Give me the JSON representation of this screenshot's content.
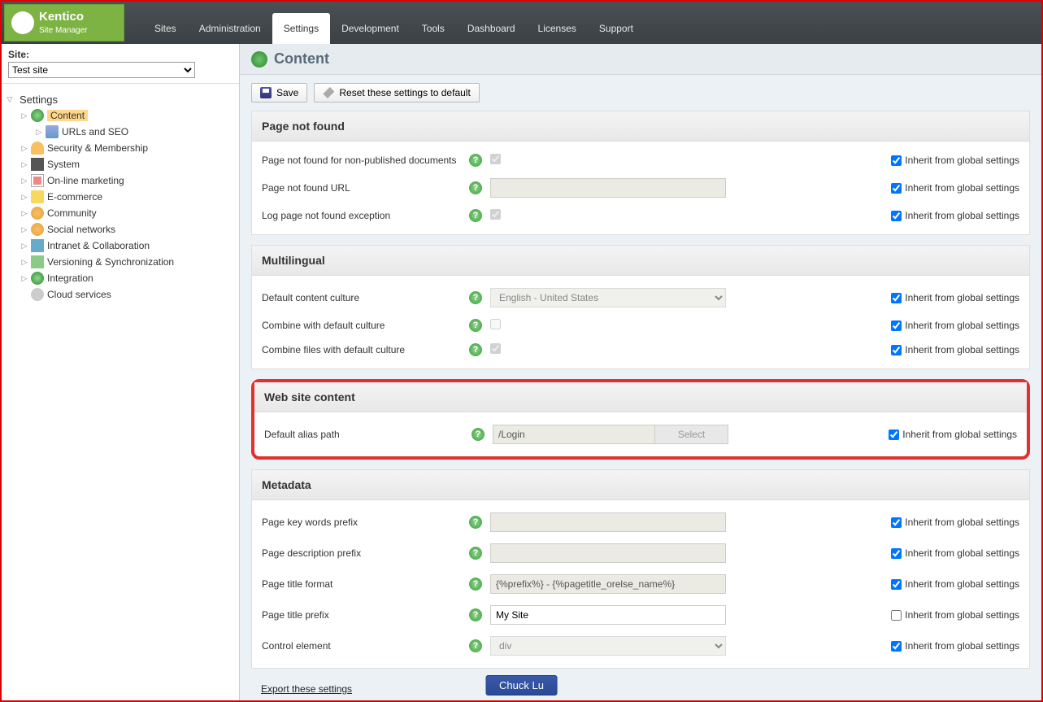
{
  "brand": {
    "name": "Kentico",
    "sub": "Site Manager"
  },
  "nav": [
    "Sites",
    "Administration",
    "Settings",
    "Development",
    "Tools",
    "Dashboard",
    "Licenses",
    "Support"
  ],
  "nav_active": 2,
  "sidebar": {
    "site_label": "Site:",
    "site_value": "Test site",
    "root": "Settings",
    "items": [
      {
        "label": "Content",
        "selected": true,
        "icon": "globe"
      },
      {
        "label": "URLs and SEO",
        "child": true,
        "icon": "i-url"
      },
      {
        "label": "Security & Membership",
        "icon": "i-sec"
      },
      {
        "label": "System",
        "icon": "i-sys"
      },
      {
        "label": "On-line marketing",
        "icon": "i-mkt"
      },
      {
        "label": "E-commerce",
        "icon": "i-ecom"
      },
      {
        "label": "Community",
        "icon": "i-comm"
      },
      {
        "label": "Social networks",
        "icon": "i-soc"
      },
      {
        "label": "Intranet & Collaboration",
        "icon": "i-intr"
      },
      {
        "label": "Versioning & Synchronization",
        "icon": "i-ver"
      },
      {
        "label": "Integration",
        "icon": "i-int"
      },
      {
        "label": "Cloud services",
        "icon": "i-cloud",
        "noexpand": true
      }
    ]
  },
  "page_title": "Content",
  "toolbar": {
    "save": "Save",
    "reset": "Reset these settings to default"
  },
  "inherit_label": "Inherit from global settings",
  "sections": [
    {
      "title": "Page not found",
      "rows": [
        {
          "label": "Page not found for non-published documents",
          "type": "checkbox",
          "checked": true,
          "disabled": true,
          "inherit": true
        },
        {
          "label": "Page not found URL",
          "type": "text",
          "value": "",
          "disabled": true,
          "inherit": true
        },
        {
          "label": "Log page not found exception",
          "type": "checkbox",
          "checked": true,
          "disabled": true,
          "inherit": true
        }
      ]
    },
    {
      "title": "Multilingual",
      "rows": [
        {
          "label": "Default content culture",
          "type": "select",
          "value": "English - United States",
          "disabled": true,
          "inherit": true
        },
        {
          "label": "Combine with default culture",
          "type": "checkbox",
          "checked": false,
          "disabled": true,
          "inherit": true
        },
        {
          "label": "Combine files with default culture",
          "type": "checkbox",
          "checked": true,
          "disabled": true,
          "inherit": true
        }
      ]
    },
    {
      "title": "Web site content",
      "highlight": true,
      "rows": [
        {
          "label": "Default alias path",
          "type": "path",
          "value": "/Login",
          "button": "Select",
          "disabled": true,
          "inherit": true
        }
      ]
    },
    {
      "title": "Metadata",
      "rows": [
        {
          "label": "Page key words prefix",
          "type": "text",
          "value": "",
          "disabled": true,
          "inherit": true
        },
        {
          "label": "Page description prefix",
          "type": "text",
          "value": "",
          "disabled": true,
          "inherit": true
        },
        {
          "label": "Page title format",
          "type": "text",
          "value": "{%prefix%} - {%pagetitle_orelse_name%}",
          "disabled": true,
          "inherit": true
        },
        {
          "label": "Page title prefix",
          "type": "text",
          "value": "My Site",
          "disabled": false,
          "inherit": false
        },
        {
          "label": "Control element",
          "type": "select",
          "value": "div",
          "disabled": true,
          "inherit": true
        }
      ]
    }
  ],
  "export_link": "Export these settings",
  "watermark": "Chuck Lu"
}
